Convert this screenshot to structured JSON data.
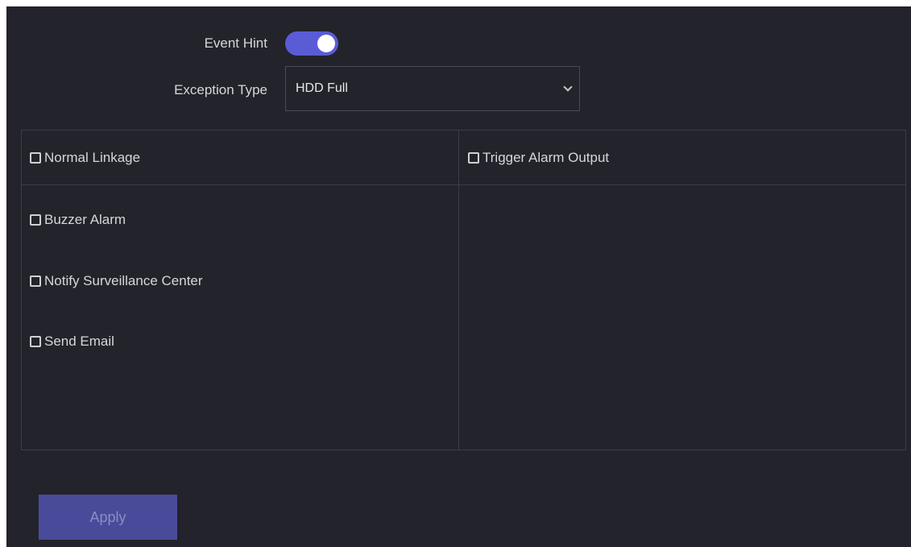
{
  "settings": {
    "event_hint": {
      "label": "Event Hint",
      "enabled": true
    },
    "exception_type": {
      "label": "Exception Type",
      "value": "HDD Full"
    }
  },
  "linkage": {
    "normal_linkage_header": "Normal Linkage",
    "trigger_alarm_output_header": "Trigger Alarm Output",
    "items": [
      {
        "label": "Buzzer Alarm",
        "checked": false
      },
      {
        "label": "Notify Surveillance Center",
        "checked": false
      },
      {
        "label": "Send Email",
        "checked": false
      }
    ]
  },
  "actions": {
    "apply_label": "Apply"
  },
  "colors": {
    "background": "#23232b",
    "accent": "#5a5cd6",
    "apply_button": "#4a4a9a",
    "border": "#3d3d45"
  }
}
